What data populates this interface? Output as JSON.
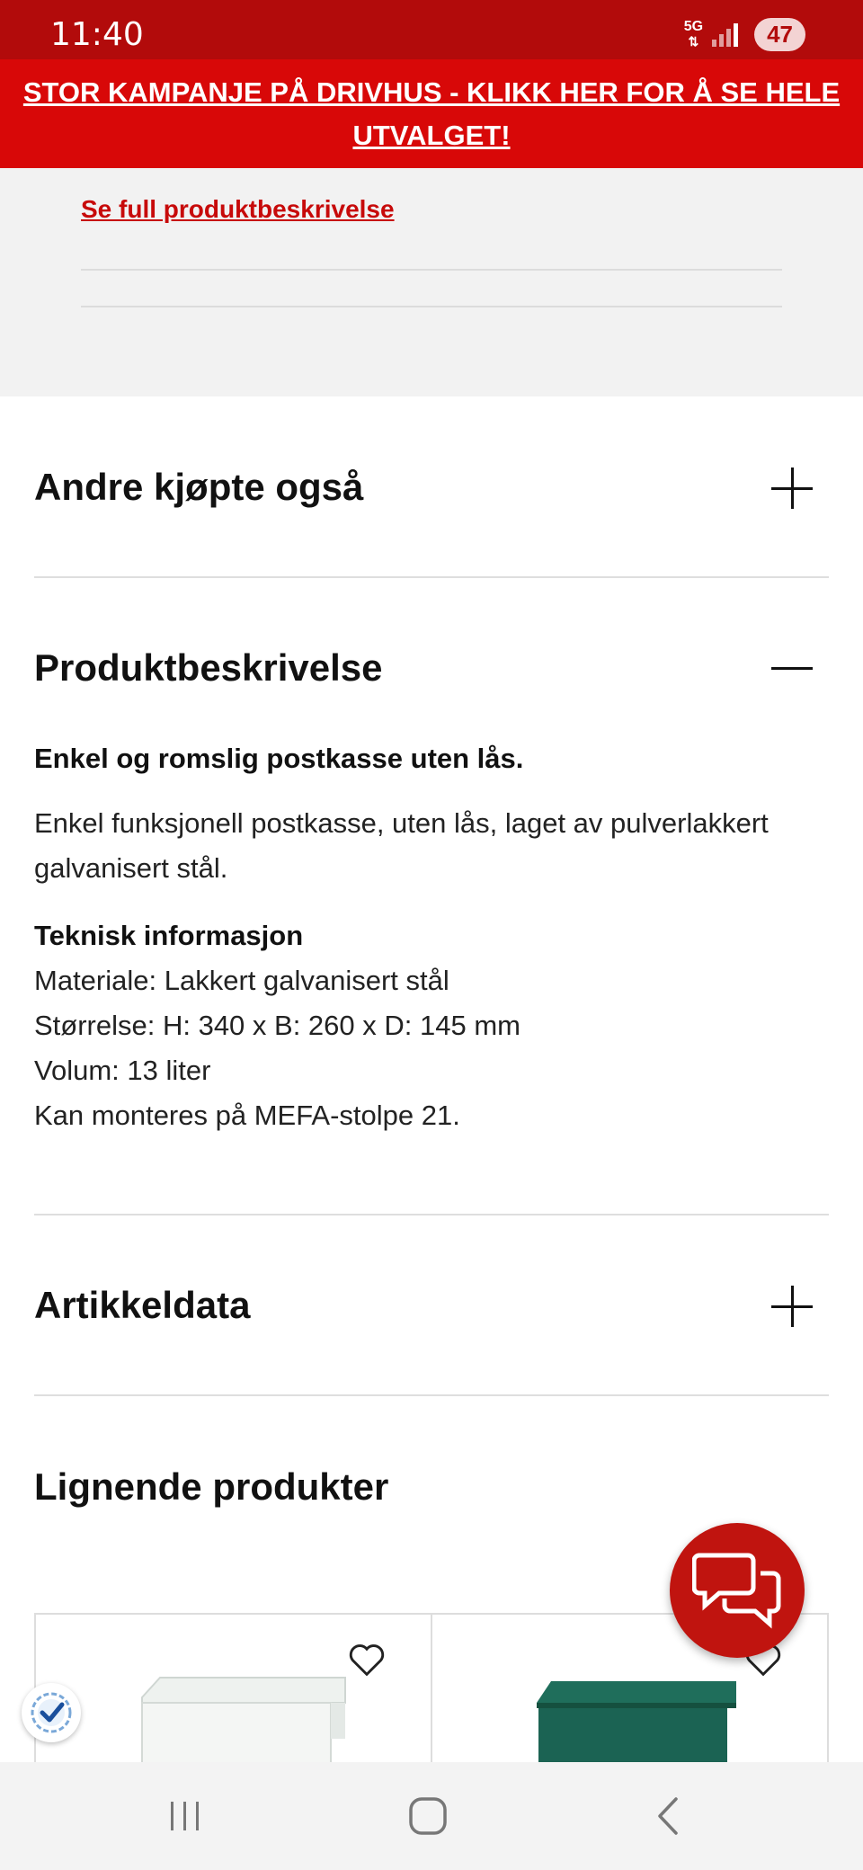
{
  "status_bar": {
    "time": "11:40",
    "network": "5G",
    "battery": "47",
    "background_color": "#b20b0b"
  },
  "promo_banner": {
    "text": "STOR KAMPANJE PÅ DRIVHUS - KLIKK HER FOR Å SE HELE UTVALGET!",
    "background_color": "#d80808"
  },
  "top_section": {
    "full_description_link": "Se full produktbeskrivelse"
  },
  "accordion": {
    "also_bought": {
      "title": "Andre kjøpte også",
      "icon": "plus-icon"
    },
    "description": {
      "title": "Produktbeskrivelse",
      "icon": "minus-icon",
      "headline": "Enkel og romslig postkasse uten lås.",
      "body": "Enkel funksjonell postkasse, uten lås, laget av pulverlakkert galvanisert stål.",
      "tech_title": "Teknisk informasjon",
      "tech_lines": [
        "Materiale: Lakkert galvanisert stål",
        "Størrelse: H: 340 x B: 260 x D: 145 mm",
        "Volum: 13 liter",
        "Kan monteres på MEFA-stolpe 21."
      ]
    },
    "article_data": {
      "title": "Artikkeldata",
      "icon": "plus-icon"
    }
  },
  "similar_products": {
    "title": "Lignende produkter",
    "products": [
      {
        "color": "#e9efec",
        "icon": "heart-icon"
      },
      {
        "color": "#1e6b59",
        "icon": "heart-icon"
      }
    ]
  },
  "floating": {
    "chat_icon": "chat-icon",
    "shield_icon": "shield-check-icon"
  },
  "nav_bar": {
    "recent_icon": "recent-apps-icon",
    "home_icon": "home-icon",
    "back_icon": "back-icon"
  }
}
